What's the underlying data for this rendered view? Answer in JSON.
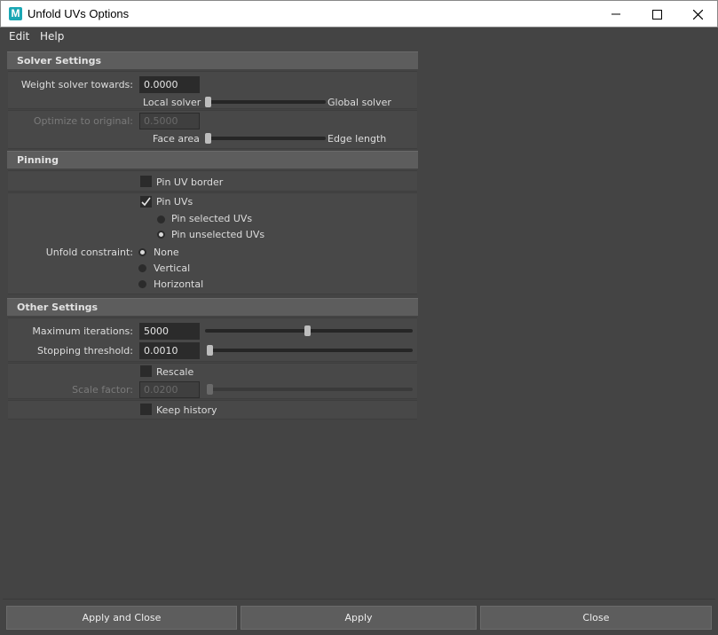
{
  "window": {
    "title": "Unfold UVs Options",
    "app_icon_letter": "M"
  },
  "menu": [
    "Edit",
    "Help"
  ],
  "sections": {
    "solver": {
      "header": "Solver Settings",
      "weight_label": "Weight solver towards:",
      "weight_value": "0.0000",
      "weight_left": "Local solver",
      "weight_right": "Global solver",
      "optimize_label": "Optimize to original:",
      "optimize_value": "0.5000",
      "optimize_left": "Face area",
      "optimize_right": "Edge length"
    },
    "pinning": {
      "header": "Pinning",
      "pin_border": "Pin UV border",
      "pin_uvs": "Pin UVs",
      "pin_selected": "Pin selected UVs",
      "pin_unselected": "Pin unselected UVs",
      "constraint_label": "Unfold constraint:",
      "constraint_none": "None",
      "constraint_vertical": "Vertical",
      "constraint_horizontal": "Horizontal"
    },
    "other": {
      "header": "Other Settings",
      "max_iter_label": "Maximum iterations:",
      "max_iter_value": "5000",
      "stop_label": "Stopping threshold:",
      "stop_value": "0.0010",
      "rescale": "Rescale",
      "scale_label": "Scale factor:",
      "scale_value": "0.0200",
      "keep_history": "Keep history"
    }
  },
  "state": {
    "pin_uv_border": false,
    "pin_uvs": true,
    "pin_mode": "unselected",
    "constraint": "None",
    "rescale": false,
    "keep_history": false,
    "weight_slider": 0.0,
    "optimize_slider": 0.0,
    "max_iterations_slider": 0.5,
    "stopping_threshold_slider": 0.0,
    "scale_factor_slider": 0.0
  },
  "buttons": {
    "apply_close": "Apply and Close",
    "apply": "Apply",
    "close": "Close"
  }
}
